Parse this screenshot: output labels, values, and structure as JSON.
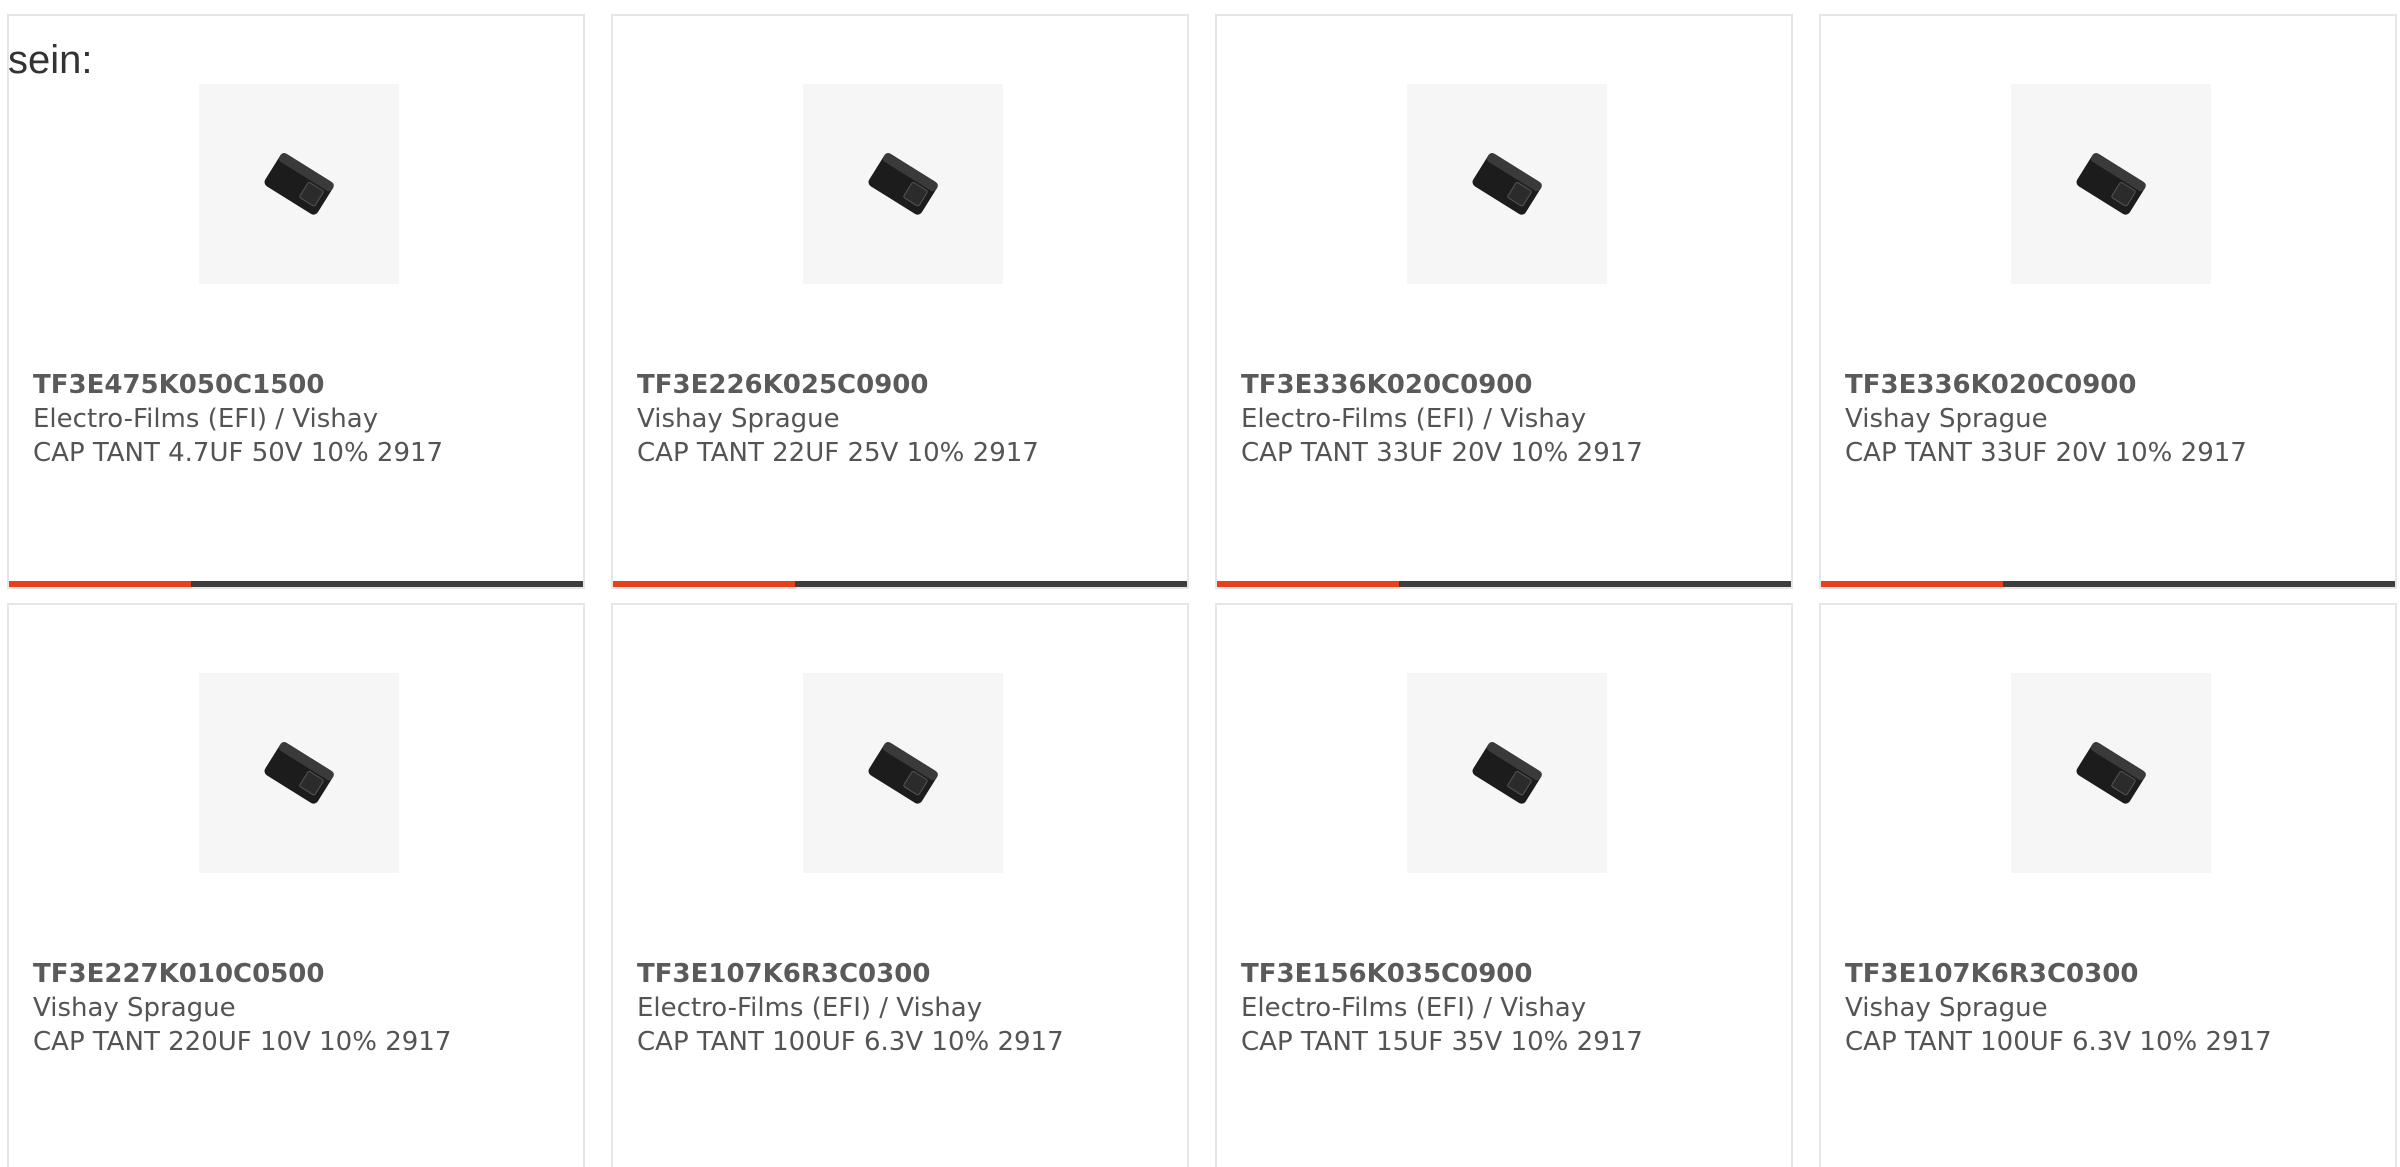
{
  "lead_text": "sein:",
  "products": [
    {
      "part_number": "TF3E475K050C1500",
      "manufacturer": "Electro-Films (EFI) / Vishay",
      "description": "CAP TANT 4.7UF 50V 10% 2917"
    },
    {
      "part_number": "TF3E226K025C0900",
      "manufacturer": "Vishay Sprague",
      "description": "CAP TANT 22UF 25V 10% 2917"
    },
    {
      "part_number": "TF3E336K020C0900",
      "manufacturer": "Electro-Films (EFI) / Vishay",
      "description": "CAP TANT 33UF 20V 10% 2917"
    },
    {
      "part_number": "TF3E336K020C0900",
      "manufacturer": "Vishay Sprague",
      "description": "CAP TANT 33UF 20V 10% 2917"
    },
    {
      "part_number": "TF3E227K010C0500",
      "manufacturer": "Vishay Sprague",
      "description": "CAP TANT 220UF 10V 10% 2917"
    },
    {
      "part_number": "TF3E107K6R3C0300",
      "manufacturer": "Electro-Films (EFI) / Vishay",
      "description": "CAP TANT 100UF 6.3V 10% 2917"
    },
    {
      "part_number": "TF3E156K035C0900",
      "manufacturer": "Electro-Films (EFI) / Vishay",
      "description": "CAP TANT 15UF 35V 10% 2917"
    },
    {
      "part_number": "TF3E107K6R3C0300",
      "manufacturer": "Vishay Sprague",
      "description": "CAP TANT 100UF 6.3V 10% 2917"
    }
  ],
  "colors": {
    "accent": "#e8401c",
    "bar": "#3d3d3d",
    "text": "#545454"
  },
  "icons": {
    "product_image": "tantalum-capacitor-chip-icon"
  }
}
